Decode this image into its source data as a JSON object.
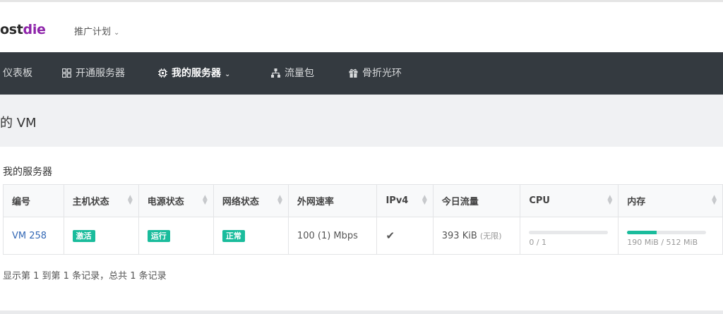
{
  "brand": {
    "logo_part1": "ost",
    "logo_part2": "die"
  },
  "topbar": {
    "promo_label": "推广计划",
    "promo_chevron": "⌄"
  },
  "nav": {
    "items": [
      {
        "label": "仪表板",
        "icon": "dashboard-icon"
      },
      {
        "label": "开通服务器",
        "icon": "grid-icon"
      },
      {
        "label": "我的服务器",
        "icon": "cpu-icon",
        "active": true
      },
      {
        "label": "流量包",
        "icon": "sitemap-icon"
      },
      {
        "label": "骨折光环",
        "icon": "gift-icon"
      }
    ],
    "chevron": "⌄"
  },
  "page": {
    "title": "的 VM"
  },
  "panel": {
    "title": "我的服务器",
    "columns": [
      "编号",
      "主机状态",
      "电源状态",
      "网络状态",
      "外网速率",
      "IPv4",
      "今日流量",
      "CPU",
      "内存"
    ],
    "rows": [
      {
        "id": "VM 258",
        "host_status": "激活",
        "power_status": "运行",
        "network_status": "正常",
        "bandwidth": "100 (1) Mbps",
        "ipv4_icon": "check-icon",
        "traffic": "393 KiB",
        "traffic_note": "(无限)",
        "cpu_text": "0 / 1",
        "cpu_fraction": 0.0,
        "memory_text": "190 MiB / 512 MiB",
        "memory_fraction": 0.37
      }
    ],
    "footer": "显示第 1 到第 1 条记录，总共 1 条记录"
  },
  "colors": {
    "nav_bg": "#343a40",
    "accent": "#1abc9c",
    "link": "#3368b5",
    "brand_purple": "#8e24aa"
  }
}
